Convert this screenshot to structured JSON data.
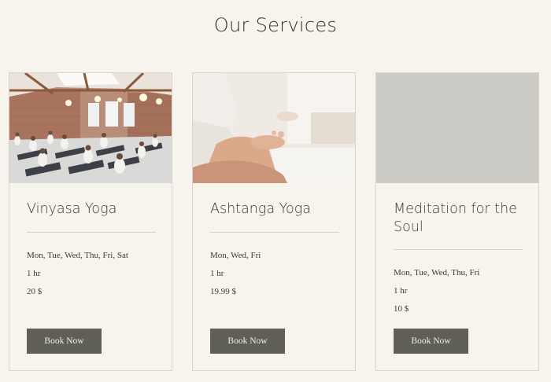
{
  "page": {
    "title": "Our Services"
  },
  "services": [
    {
      "title": "Vinyasa Yoga",
      "days": "Mon, Tue, Wed, Thu, Fri, Sat",
      "duration": "1 hr",
      "price": "20 $",
      "button_label": "Book Now",
      "image": "yoga-class-studio-photo"
    },
    {
      "title": "Ashtanga Yoga",
      "days": "Mon, Wed, Fri",
      "duration": "1 hr",
      "price": "19.99 $",
      "button_label": "Book Now",
      "image": "meditation-hands-photo"
    },
    {
      "title": "Meditation for the Soul",
      "days": "Mon, Tue, Wed, Thu, Fri",
      "duration": "1 hr",
      "price": "10 $",
      "button_label": "Book Now",
      "image": "placeholder-gray"
    }
  ],
  "colors": {
    "background": "#f7f4ee",
    "button": "#5f5f58",
    "border": "#d9d5cc",
    "placeholder": "#cdcbc5"
  }
}
